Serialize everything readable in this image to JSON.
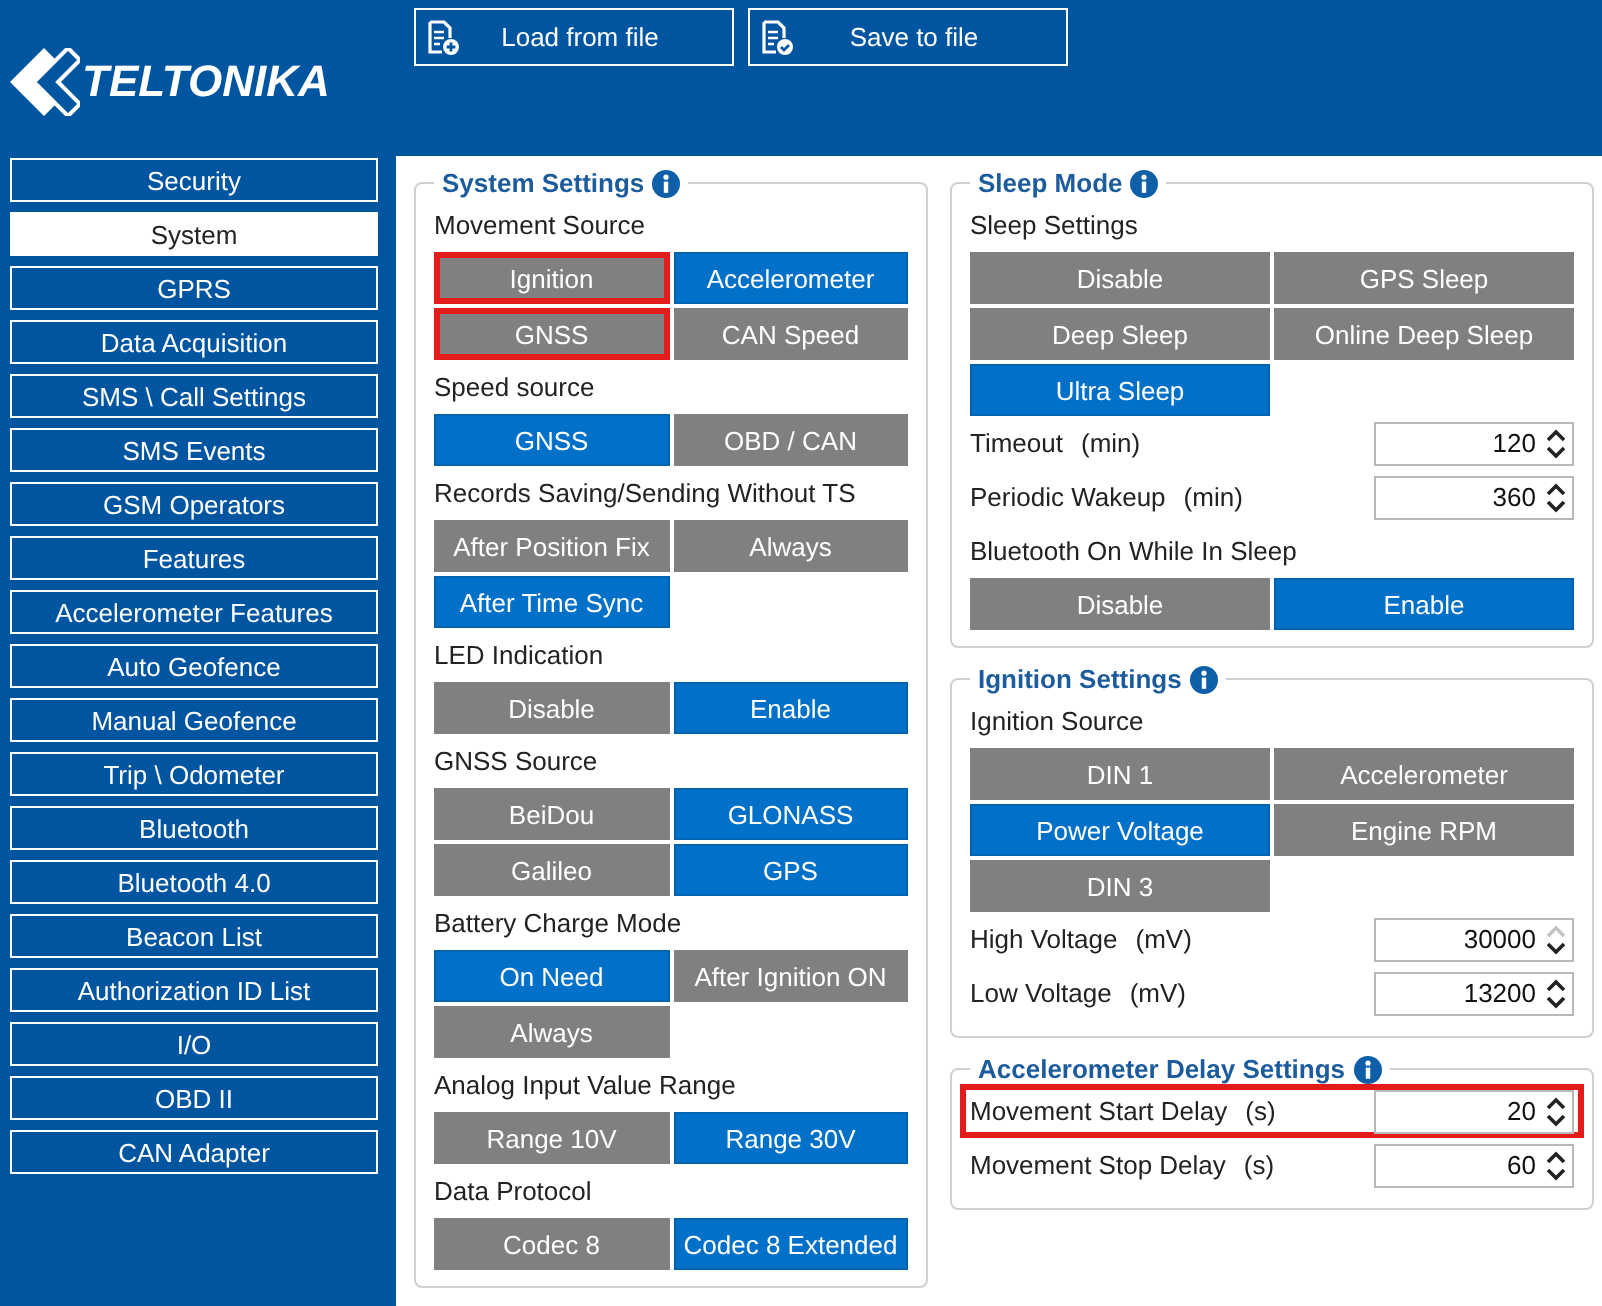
{
  "logo": {
    "text": "TELTONIKA"
  },
  "toolbar": [
    {
      "label": "Load from file",
      "kind": "load"
    },
    {
      "label": "Save to file",
      "kind": "save"
    }
  ],
  "sidebar": {
    "items": [
      {
        "label": "Security",
        "selected": false
      },
      {
        "label": "System",
        "selected": true
      },
      {
        "label": "GPRS",
        "selected": false
      },
      {
        "label": "Data Acquisition",
        "selected": false
      },
      {
        "label": "SMS \\ Call Settings",
        "selected": false
      },
      {
        "label": "SMS Events",
        "selected": false
      },
      {
        "label": "GSM Operators",
        "selected": false
      },
      {
        "label": "Features",
        "selected": false
      },
      {
        "label": "Accelerometer Features",
        "selected": false
      },
      {
        "label": "Auto Geofence",
        "selected": false
      },
      {
        "label": "Manual Geofence",
        "selected": false
      },
      {
        "label": "Trip \\ Odometer",
        "selected": false
      },
      {
        "label": "Bluetooth",
        "selected": false
      },
      {
        "label": "Bluetooth 4.0",
        "selected": false
      },
      {
        "label": "Beacon List",
        "selected": false
      },
      {
        "label": "Authorization ID List",
        "selected": false
      },
      {
        "label": "I/O",
        "selected": false
      },
      {
        "label": "OBD II",
        "selected": false
      },
      {
        "label": "CAN Adapter",
        "selected": false
      }
    ]
  },
  "columns": [
    {
      "panels": [
        {
          "title": "System Settings",
          "sections": [
            {
              "kind": "options",
              "label": "Movement Source",
              "options": [
                {
                  "label": "Ignition",
                  "selected": false,
                  "highlighted": true
                },
                {
                  "label": "Accelerometer",
                  "selected": true,
                  "highlighted": false
                },
                {
                  "label": "GNSS",
                  "selected": false,
                  "highlighted": true
                },
                {
                  "label": "CAN Speed",
                  "selected": false,
                  "highlighted": false
                }
              ]
            },
            {
              "kind": "options",
              "label": "Speed source",
              "options": [
                {
                  "label": "GNSS",
                  "selected": true,
                  "highlighted": false
                },
                {
                  "label": "OBD / CAN",
                  "selected": false,
                  "highlighted": false
                }
              ]
            },
            {
              "kind": "options",
              "label": "Records Saving/Sending Without TS",
              "options": [
                {
                  "label": "After Position Fix",
                  "selected": false,
                  "highlighted": false
                },
                {
                  "label": "Always",
                  "selected": false,
                  "highlighted": false
                },
                {
                  "label": "After Time Sync",
                  "selected": true,
                  "highlighted": false
                }
              ]
            },
            {
              "kind": "options",
              "label": "LED Indication",
              "options": [
                {
                  "label": "Disable",
                  "selected": false,
                  "highlighted": false
                },
                {
                  "label": "Enable",
                  "selected": true,
                  "highlighted": false
                }
              ]
            },
            {
              "kind": "options",
              "label": "GNSS Source",
              "options": [
                {
                  "label": "BeiDou",
                  "selected": false,
                  "highlighted": false
                },
                {
                  "label": "GLONASS",
                  "selected": true,
                  "highlighted": false
                },
                {
                  "label": "Galileo",
                  "selected": false,
                  "highlighted": false
                },
                {
                  "label": "GPS",
                  "selected": true,
                  "highlighted": false
                }
              ]
            },
            {
              "kind": "options",
              "label": "Battery Charge Mode",
              "options": [
                {
                  "label": "On Need",
                  "selected": true,
                  "highlighted": false
                },
                {
                  "label": "After Ignition ON",
                  "selected": false,
                  "highlighted": false
                },
                {
                  "label": "Always",
                  "selected": false,
                  "highlighted": false
                }
              ]
            },
            {
              "kind": "options",
              "label": "Analog Input Value Range",
              "options": [
                {
                  "label": "Range 10V",
                  "selected": false,
                  "highlighted": false
                },
                {
                  "label": "Range 30V",
                  "selected": true,
                  "highlighted": false
                }
              ]
            },
            {
              "kind": "options",
              "label": "Data Protocol",
              "options": [
                {
                  "label": "Codec 8",
                  "selected": false,
                  "highlighted": false
                },
                {
                  "label": "Codec 8 Extended",
                  "selected": true,
                  "highlighted": false
                }
              ]
            }
          ]
        }
      ]
    },
    {
      "panels": [
        {
          "title": "Sleep Mode",
          "sections": [
            {
              "kind": "options",
              "label": "Sleep Settings",
              "options": [
                {
                  "label": "Disable",
                  "selected": false,
                  "highlighted": false
                },
                {
                  "label": "GPS Sleep",
                  "selected": false,
                  "highlighted": false
                },
                {
                  "label": "Deep Sleep",
                  "selected": false,
                  "highlighted": false
                },
                {
                  "label": "Online Deep Sleep",
                  "selected": false,
                  "highlighted": false
                },
                {
                  "label": "Ultra Sleep",
                  "selected": true,
                  "highlighted": false
                }
              ]
            },
            {
              "kind": "number",
              "label": "Timeout",
              "unit": "(min)",
              "value": "120",
              "highlighted": false,
              "up_disabled": false
            },
            {
              "kind": "number",
              "label": "Periodic Wakeup",
              "unit": "(min)",
              "value": "360",
              "highlighted": false,
              "up_disabled": false
            },
            {
              "kind": "options",
              "label": "Bluetooth On While In Sleep",
              "options": [
                {
                  "label": "Disable",
                  "selected": false,
                  "highlighted": false
                },
                {
                  "label": "Enable",
                  "selected": true,
                  "highlighted": false
                }
              ]
            }
          ]
        },
        {
          "title": "Ignition Settings",
          "sections": [
            {
              "kind": "options",
              "label": "Ignition Source",
              "options": [
                {
                  "label": "DIN 1",
                  "selected": false,
                  "highlighted": false
                },
                {
                  "label": "Accelerometer",
                  "selected": false,
                  "highlighted": false
                },
                {
                  "label": "Power Voltage",
                  "selected": true,
                  "highlighted": false
                },
                {
                  "label": "Engine RPM",
                  "selected": false,
                  "highlighted": false
                },
                {
                  "label": "DIN 3",
                  "selected": false,
                  "highlighted": false
                }
              ]
            },
            {
              "kind": "number",
              "label": "High Voltage",
              "unit": "(mV)",
              "value": "30000",
              "highlighted": false,
              "up_disabled": true
            },
            {
              "kind": "number",
              "label": "Low Voltage",
              "unit": "(mV)",
              "value": "13200",
              "highlighted": false,
              "up_disabled": false
            }
          ]
        },
        {
          "title": "Accelerometer Delay Settings",
          "sections": [
            {
              "kind": "number",
              "label": "Movement Start Delay",
              "unit": "(s)",
              "value": "20",
              "highlighted": true,
              "up_disabled": false
            },
            {
              "kind": "number",
              "label": "Movement Stop Delay",
              "unit": "(s)",
              "value": "60",
              "highlighted": false,
              "up_disabled": false
            }
          ]
        }
      ]
    }
  ]
}
